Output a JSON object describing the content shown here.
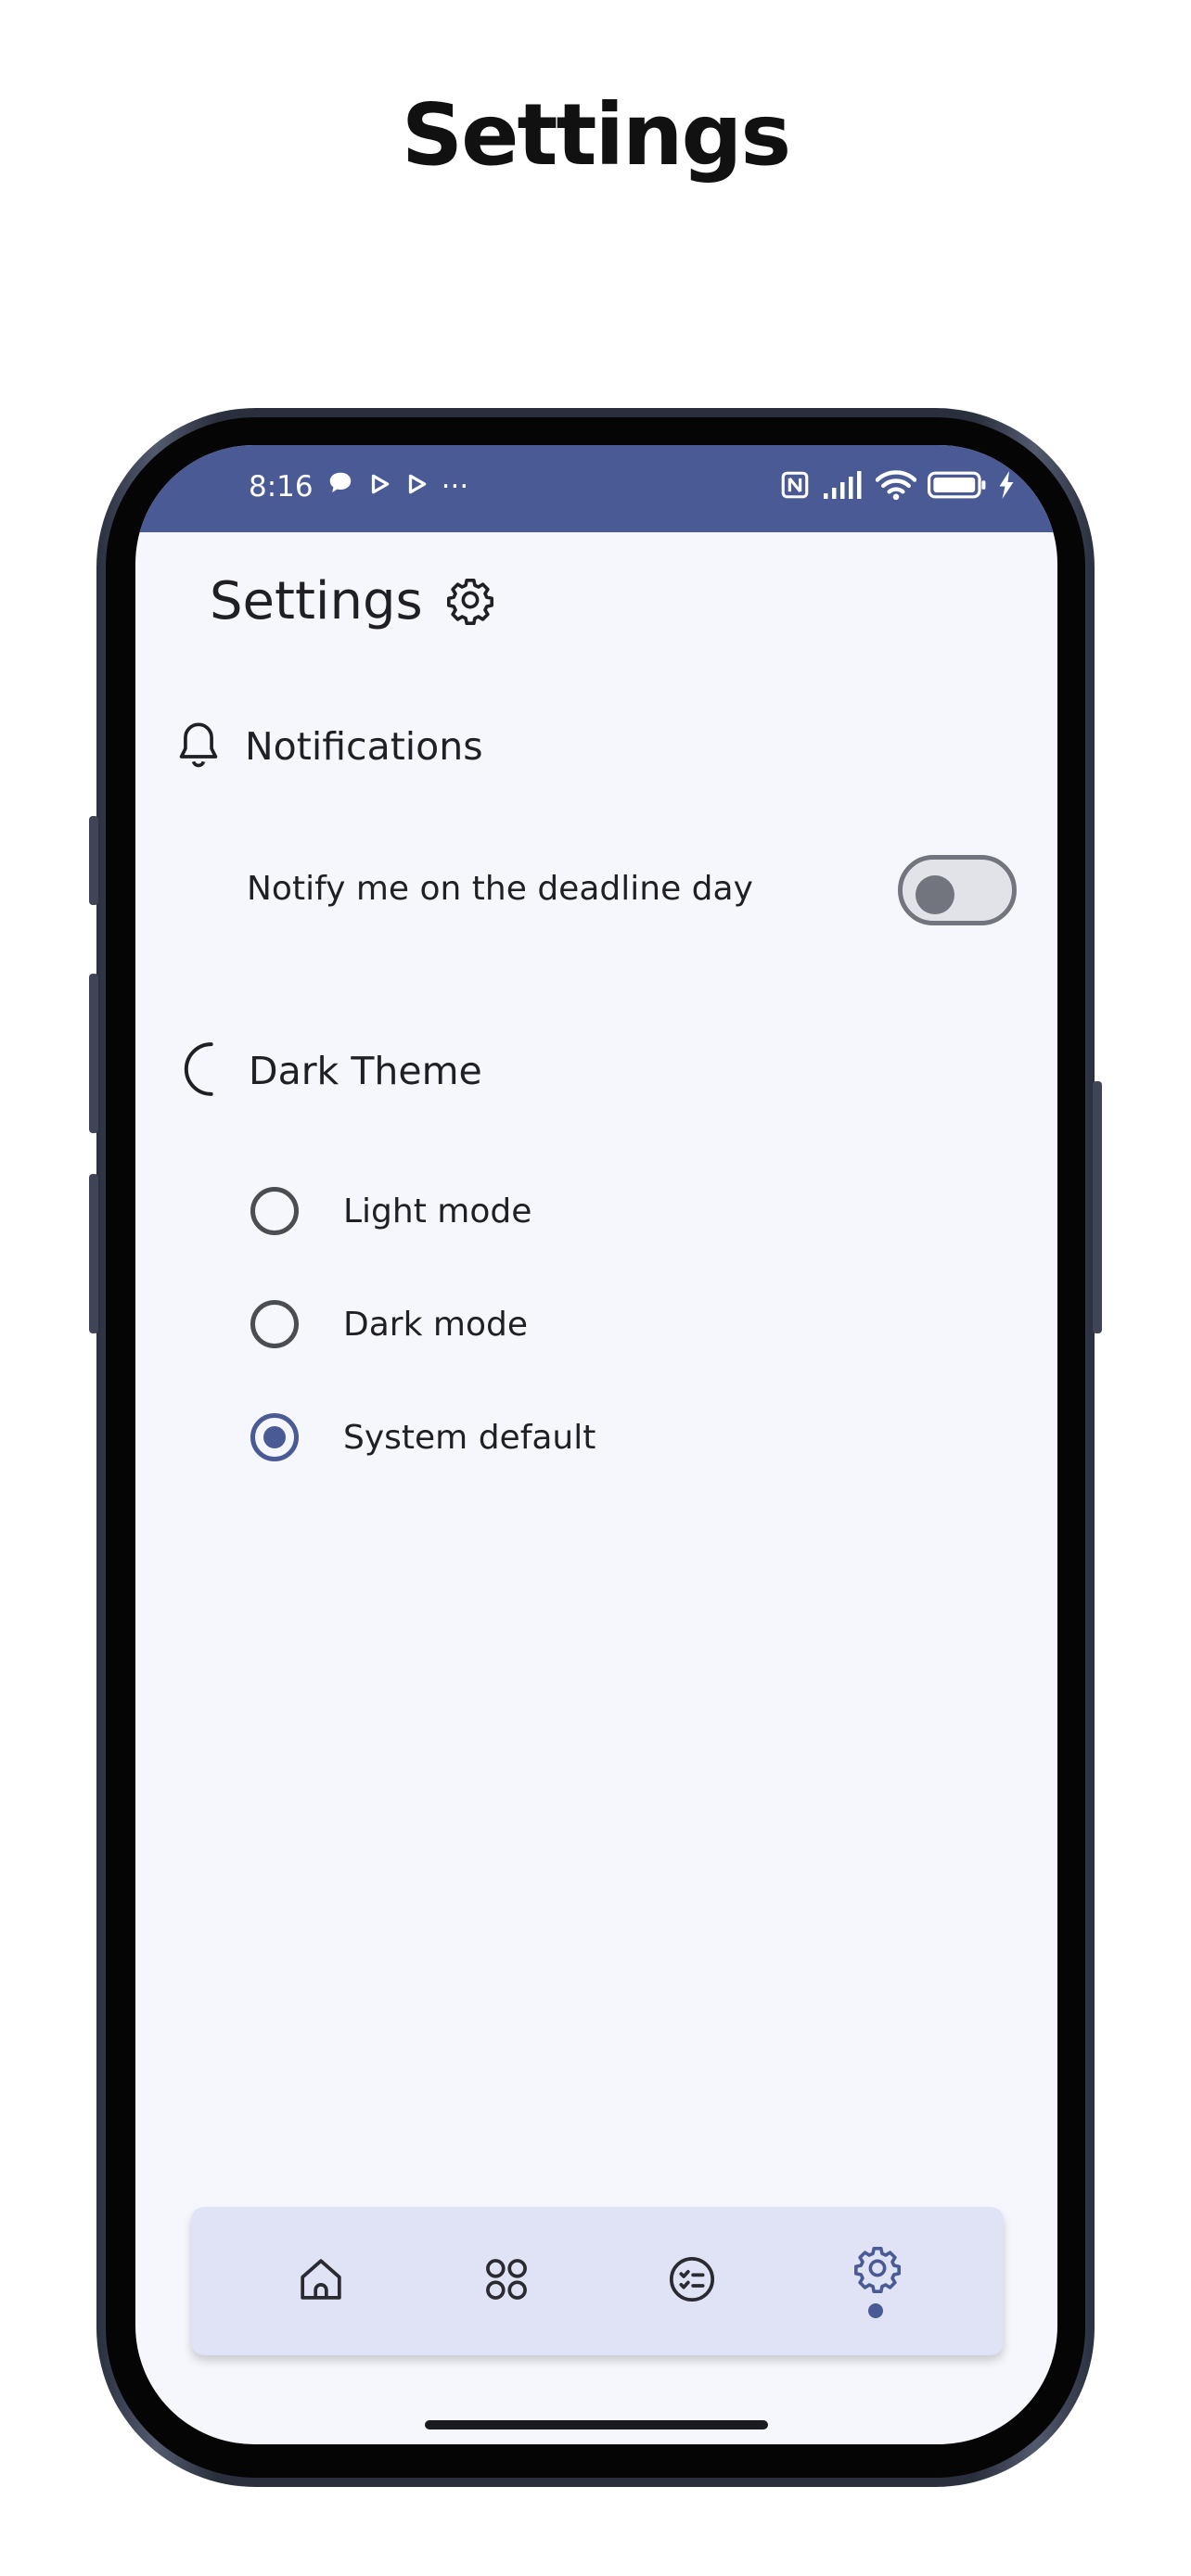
{
  "page": {
    "title": "Settings"
  },
  "status_bar": {
    "time": "8:16",
    "more": "···",
    "icons": [
      "chat-bubble-icon",
      "play-icon",
      "play-icon",
      "nfc-icon",
      "signal-icon",
      "wifi-icon",
      "battery-icon",
      "charging-icon"
    ]
  },
  "app": {
    "title": "Settings",
    "title_icon": "gear-icon",
    "sections": {
      "notifications": {
        "title": "Notifications",
        "icon": "bell-icon",
        "option_label": "Notify me on the deadline day",
        "toggle_on": false
      },
      "theme": {
        "title": "Dark Theme",
        "icon": "moon-icon",
        "options": [
          {
            "label": "Light mode",
            "selected": false
          },
          {
            "label": "Dark mode",
            "selected": false
          },
          {
            "label": "System default",
            "selected": true
          }
        ]
      }
    },
    "bottom_nav": {
      "items": [
        {
          "icon": "home-icon",
          "active": false
        },
        {
          "icon": "grid-icon",
          "active": false
        },
        {
          "icon": "task-list-icon",
          "active": false
        },
        {
          "icon": "gear-icon",
          "active": true
        }
      ]
    }
  },
  "colors": {
    "accent": "#4a5a95",
    "screen_background": "#f6f7fc",
    "nav_background": "#e0e3f5",
    "text": "#1f1f24"
  }
}
